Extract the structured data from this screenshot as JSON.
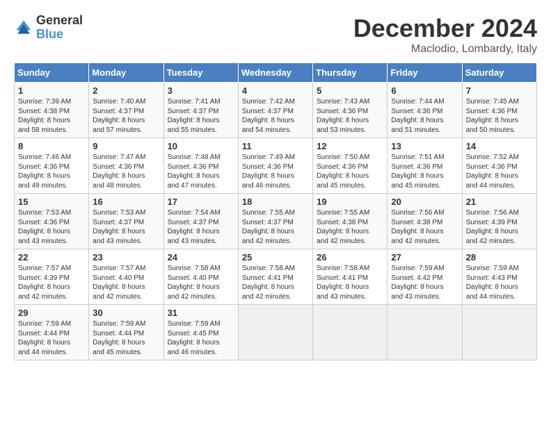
{
  "logo": {
    "general": "General",
    "blue": "Blue"
  },
  "title": "December 2024",
  "location": "Maclodio, Lombardy, Italy",
  "days_of_week": [
    "Sunday",
    "Monday",
    "Tuesday",
    "Wednesday",
    "Thursday",
    "Friday",
    "Saturday"
  ],
  "weeks": [
    [
      {
        "day": "1",
        "text": "Sunrise: 7:39 AM\nSunset: 4:38 PM\nDaylight: 8 hours\nand 58 minutes."
      },
      {
        "day": "2",
        "text": "Sunrise: 7:40 AM\nSunset: 4:37 PM\nDaylight: 8 hours\nand 57 minutes."
      },
      {
        "day": "3",
        "text": "Sunrise: 7:41 AM\nSunset: 4:37 PM\nDaylight: 8 hours\nand 55 minutes."
      },
      {
        "day": "4",
        "text": "Sunrise: 7:42 AM\nSunset: 4:37 PM\nDaylight: 8 hours\nand 54 minutes."
      },
      {
        "day": "5",
        "text": "Sunrise: 7:43 AM\nSunset: 4:36 PM\nDaylight: 8 hours\nand 53 minutes."
      },
      {
        "day": "6",
        "text": "Sunrise: 7:44 AM\nSunset: 4:36 PM\nDaylight: 8 hours\nand 51 minutes."
      },
      {
        "day": "7",
        "text": "Sunrise: 7:45 AM\nSunset: 4:36 PM\nDaylight: 8 hours\nand 50 minutes."
      }
    ],
    [
      {
        "day": "8",
        "text": "Sunrise: 7:46 AM\nSunset: 4:36 PM\nDaylight: 8 hours\nand 49 minutes."
      },
      {
        "day": "9",
        "text": "Sunrise: 7:47 AM\nSunset: 4:36 PM\nDaylight: 8 hours\nand 48 minutes."
      },
      {
        "day": "10",
        "text": "Sunrise: 7:48 AM\nSunset: 4:36 PM\nDaylight: 8 hours\nand 47 minutes."
      },
      {
        "day": "11",
        "text": "Sunrise: 7:49 AM\nSunset: 4:36 PM\nDaylight: 8 hours\nand 46 minutes."
      },
      {
        "day": "12",
        "text": "Sunrise: 7:50 AM\nSunset: 4:36 PM\nDaylight: 8 hours\nand 45 minutes."
      },
      {
        "day": "13",
        "text": "Sunrise: 7:51 AM\nSunset: 4:36 PM\nDaylight: 8 hours\nand 45 minutes."
      },
      {
        "day": "14",
        "text": "Sunrise: 7:52 AM\nSunset: 4:36 PM\nDaylight: 8 hours\nand 44 minutes."
      }
    ],
    [
      {
        "day": "15",
        "text": "Sunrise: 7:53 AM\nSunset: 4:36 PM\nDaylight: 8 hours\nand 43 minutes."
      },
      {
        "day": "16",
        "text": "Sunrise: 7:53 AM\nSunset: 4:37 PM\nDaylight: 8 hours\nand 43 minutes."
      },
      {
        "day": "17",
        "text": "Sunrise: 7:54 AM\nSunset: 4:37 PM\nDaylight: 8 hours\nand 43 minutes."
      },
      {
        "day": "18",
        "text": "Sunrise: 7:55 AM\nSunset: 4:37 PM\nDaylight: 8 hours\nand 42 minutes."
      },
      {
        "day": "19",
        "text": "Sunrise: 7:55 AM\nSunset: 4:38 PM\nDaylight: 8 hours\nand 42 minutes."
      },
      {
        "day": "20",
        "text": "Sunrise: 7:56 AM\nSunset: 4:38 PM\nDaylight: 8 hours\nand 42 minutes."
      },
      {
        "day": "21",
        "text": "Sunrise: 7:56 AM\nSunset: 4:39 PM\nDaylight: 8 hours\nand 42 minutes."
      }
    ],
    [
      {
        "day": "22",
        "text": "Sunrise: 7:57 AM\nSunset: 4:39 PM\nDaylight: 8 hours\nand 42 minutes."
      },
      {
        "day": "23",
        "text": "Sunrise: 7:57 AM\nSunset: 4:40 PM\nDaylight: 8 hours\nand 42 minutes."
      },
      {
        "day": "24",
        "text": "Sunrise: 7:58 AM\nSunset: 4:40 PM\nDaylight: 8 hours\nand 42 minutes."
      },
      {
        "day": "25",
        "text": "Sunrise: 7:58 AM\nSunset: 4:41 PM\nDaylight: 8 hours\nand 42 minutes."
      },
      {
        "day": "26",
        "text": "Sunrise: 7:58 AM\nSunset: 4:41 PM\nDaylight: 8 hours\nand 43 minutes."
      },
      {
        "day": "27",
        "text": "Sunrise: 7:59 AM\nSunset: 4:42 PM\nDaylight: 8 hours\nand 43 minutes."
      },
      {
        "day": "28",
        "text": "Sunrise: 7:59 AM\nSunset: 4:43 PM\nDaylight: 8 hours\nand 44 minutes."
      }
    ],
    [
      {
        "day": "29",
        "text": "Sunrise: 7:59 AM\nSunset: 4:44 PM\nDaylight: 8 hours\nand 44 minutes."
      },
      {
        "day": "30",
        "text": "Sunrise: 7:59 AM\nSunset: 4:44 PM\nDaylight: 8 hours\nand 45 minutes."
      },
      {
        "day": "31",
        "text": "Sunrise: 7:59 AM\nSunset: 4:45 PM\nDaylight: 8 hours\nand 46 minutes."
      },
      {
        "day": "",
        "text": ""
      },
      {
        "day": "",
        "text": ""
      },
      {
        "day": "",
        "text": ""
      },
      {
        "day": "",
        "text": ""
      }
    ]
  ]
}
